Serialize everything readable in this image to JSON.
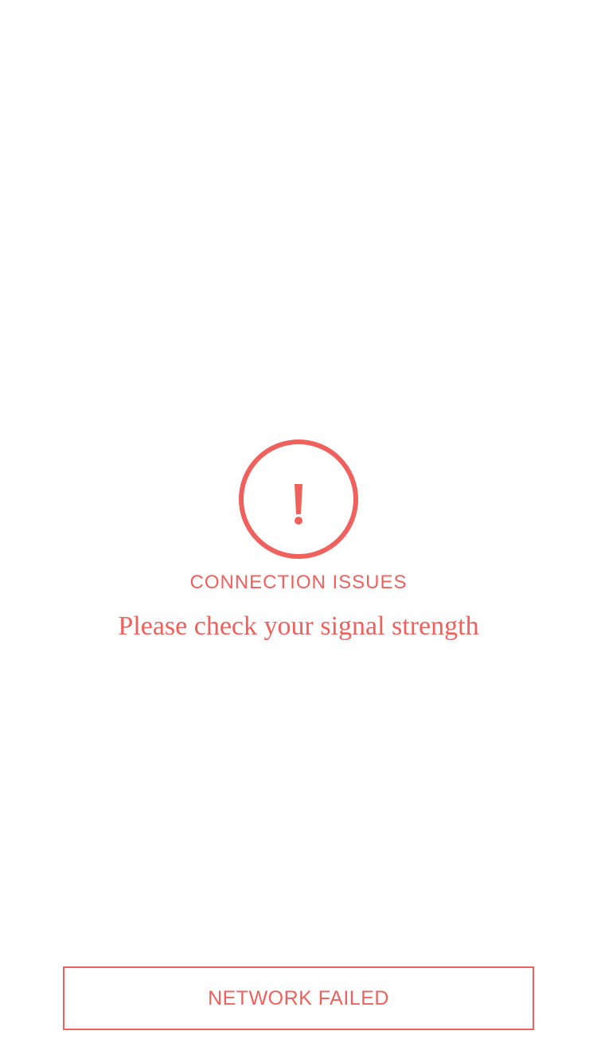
{
  "alert": {
    "icon": "exclamation-icon",
    "title": "CONNECTION ISSUES",
    "message": "Please check your signal strength"
  },
  "footer": {
    "status_label": "NETWORK FAILED"
  },
  "colors": {
    "accent": "#f0605d",
    "background": "#ffffff"
  }
}
